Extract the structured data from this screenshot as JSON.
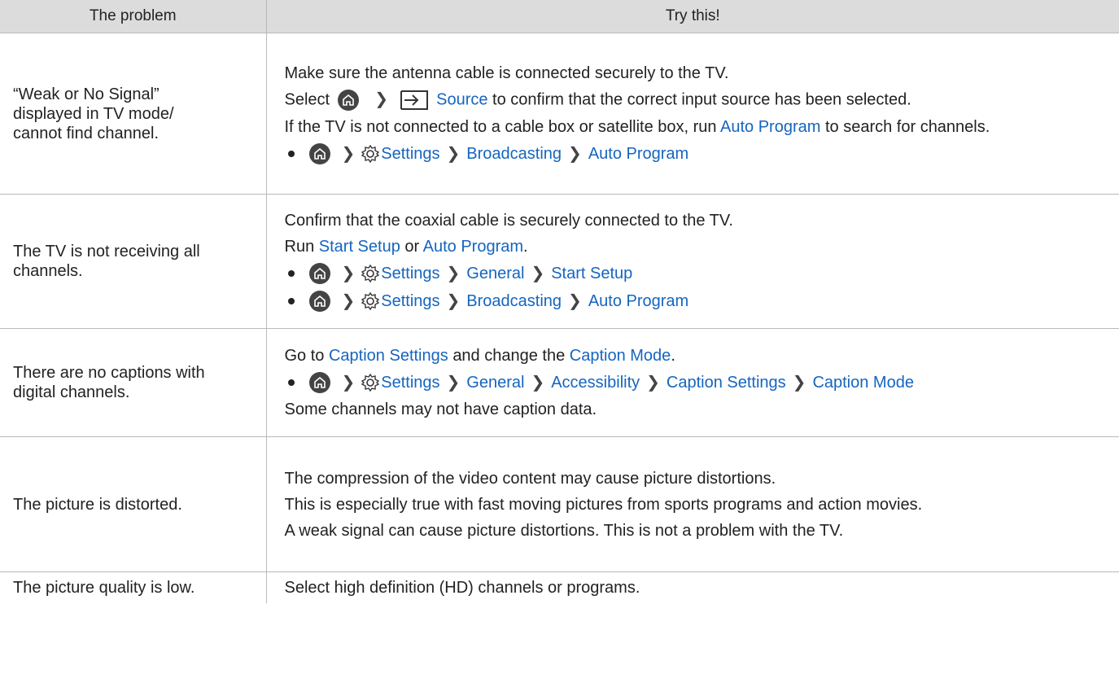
{
  "table": {
    "headers": [
      "The problem",
      "Try this!"
    ],
    "rows": [
      {
        "problem": "“Weak or No Signal” displayed in TV mode/ cannot find channel.",
        "lines": {
          "l1": "Make sure the antenna cable is connected securely to the TV.",
          "l2_pre": "Select",
          "l2_source": "Source",
          "l2_post": "to confirm that the correct input source has been selected.",
          "l3_pre": "If the TV is not connected to a cable box or satellite box, run",
          "l3_hl": "Auto Program",
          "l3_post": "to search for channels.",
          "path": [
            "Settings",
            "Broadcasting",
            "Auto Program"
          ]
        }
      },
      {
        "problem": "The TV is not receiving all channels.",
        "lines": {
          "l1": "Confirm that the coaxial cable is securely connected to the TV.",
          "l2_pre": "Run",
          "l2_hl1": "Start Setup",
          "l2_mid": "or",
          "l2_hl2": "Auto Program",
          "l2_post": ".",
          "path1": [
            "Settings",
            "General",
            "Start Setup"
          ],
          "path2": [
            "Settings",
            "Broadcasting",
            "Auto Program"
          ]
        }
      },
      {
        "problem": "There are no captions with digital channels.",
        "lines": {
          "l1_pre": "Go to",
          "l1_hl1": "Caption Settings",
          "l1_mid": "and change the",
          "l1_hl2": "Caption Mode",
          "l1_post": ".",
          "path": [
            "Settings",
            "General",
            "Accessibility",
            "Caption Settings",
            "Caption Mode"
          ],
          "l3": "Some channels may not have caption data."
        }
      },
      {
        "problem": "The picture is distorted.",
        "lines": {
          "l1": "The compression of the video content may cause picture distortions.",
          "l2": "This is especially true with fast moving pictures from sports programs and action movies.",
          "l3": "A weak signal can cause picture distortions. This is not a problem with the TV."
        }
      },
      {
        "problem": "The picture quality is low.",
        "lines": {
          "l1": "Select high definition (HD) channels or programs."
        }
      }
    ]
  },
  "icons": {
    "home": "home-icon",
    "source": "source-icon",
    "settings": "gear-icon",
    "arrow": "chevron-right-icon",
    "bullet": "bullet-icon"
  },
  "colors": {
    "highlight": "#1565c0",
    "header_bg": "#dcdcdc",
    "border": "#b9b9b9"
  }
}
